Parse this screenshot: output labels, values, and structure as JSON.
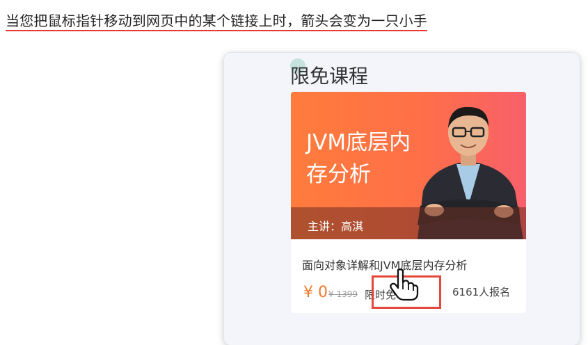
{
  "caption": "当您把鼠标指针移动到网页中的某个链接上时，箭头会变为一只小手",
  "section": {
    "title": "限免课程"
  },
  "course": {
    "banner_title": "JVM底层内存分析",
    "teacher": "主讲：高淇",
    "name": "面向对象详解和JVM底层内存分析",
    "price": "¥ 0",
    "original_price": "¥ 1399",
    "free_tag": "限时免",
    "enroll_count": "6161人报名"
  },
  "colors": {
    "accent": "#f27a2a",
    "banner_start": "#ff7c3c",
    "banner_end": "#f8606a",
    "highlight": "#e3463a",
    "underline": "#e53935"
  },
  "icons": {
    "cursor": "hand-pointer-icon"
  }
}
